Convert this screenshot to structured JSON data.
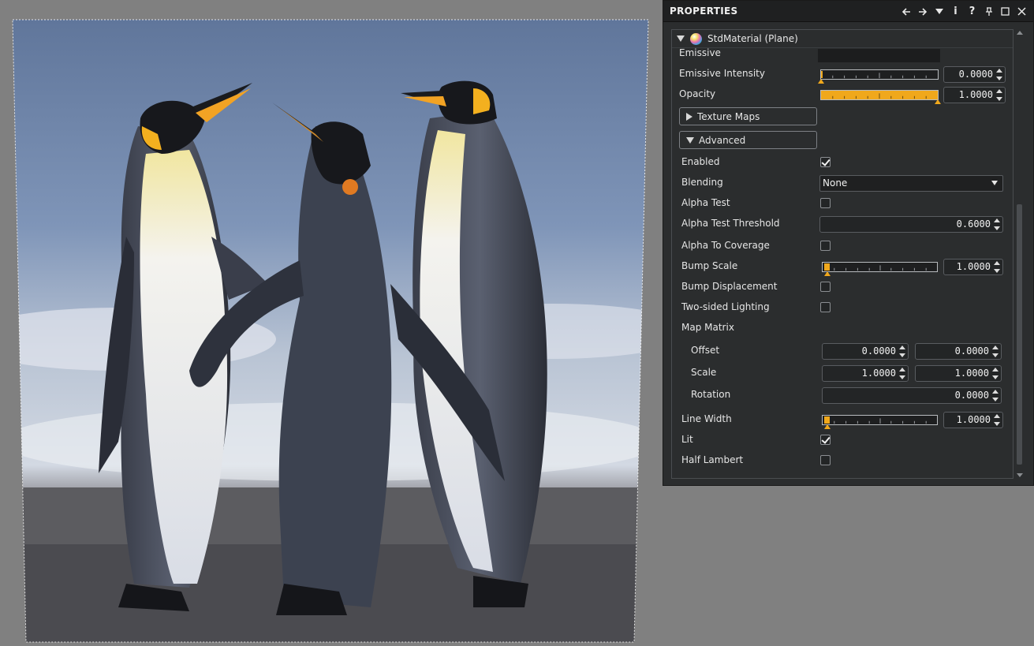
{
  "panel": {
    "title": "PROPERTIES",
    "header_icons": [
      "arrow-left-icon",
      "arrow-right-icon",
      "dropdown-icon",
      "info-icon",
      "help-icon",
      "pin-icon",
      "maximize-icon",
      "close-icon"
    ],
    "header_glyphs": {
      "info": "i",
      "help": "?"
    }
  },
  "material": {
    "name": "StdMaterial (Plane)",
    "icon": "material-sphere-icon"
  },
  "props": {
    "emissive": {
      "label": "Emissive"
    },
    "emissive_intensity": {
      "label": "Emissive Intensity",
      "value": "0.0000",
      "fraction": 0.0
    },
    "opacity": {
      "label": "Opacity",
      "value": "1.0000",
      "fraction": 1.0
    },
    "texture_maps": {
      "label": "Texture Maps",
      "expanded": false
    },
    "advanced": {
      "label": "Advanced",
      "expanded": true
    },
    "enabled": {
      "label": "Enabled",
      "checked": true
    },
    "blending": {
      "label": "Blending",
      "value": "None"
    },
    "alpha_test": {
      "label": "Alpha Test",
      "checked": false
    },
    "alpha_test_threshold": {
      "label": "Alpha Test Threshold",
      "value": "0.6000"
    },
    "alpha_to_coverage": {
      "label": "Alpha To Coverage",
      "checked": false
    },
    "bump_scale": {
      "label": "Bump Scale",
      "value": "1.0000",
      "fraction": 0.0
    },
    "bump_displacement": {
      "label": "Bump Displacement",
      "checked": false
    },
    "two_sided_lighting": {
      "label": "Two-sided Lighting",
      "checked": false
    },
    "map_matrix": {
      "label": "Map Matrix",
      "offset": {
        "label": "Offset",
        "x": "0.0000",
        "y": "0.0000"
      },
      "scale": {
        "label": "Scale",
        "x": "1.0000",
        "y": "1.0000"
      },
      "rotation": {
        "label": "Rotation",
        "value": "0.0000"
      }
    },
    "line_width": {
      "label": "Line Width",
      "value": "1.0000",
      "fraction": 0.0
    },
    "lit": {
      "label": "Lit",
      "checked": true
    },
    "half_lambert": {
      "label": "Half Lambert",
      "checked": false
    }
  },
  "colors": {
    "accent": "#f0a81c",
    "panel_bg": "#2b2d2e",
    "viewport_bg": "#808080"
  }
}
